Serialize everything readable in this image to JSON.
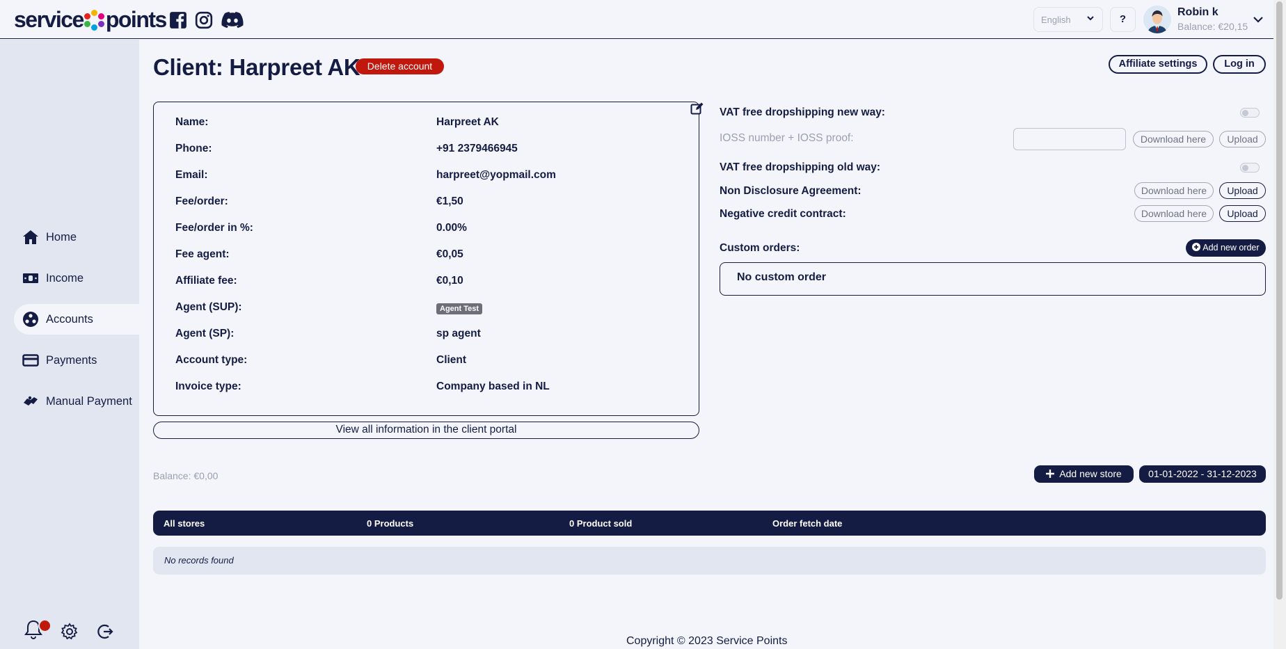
{
  "header": {
    "logo_part1": "service",
    "logo_part2": "points",
    "language": "English",
    "help_label": "?",
    "user_name": "Robin k",
    "user_balance": "Balance: €20,15"
  },
  "sidebar": {
    "items": [
      {
        "label": "Home",
        "icon": "home-icon"
      },
      {
        "label": "Income",
        "icon": "money-icon"
      },
      {
        "label": "Accounts",
        "icon": "accounts-icon"
      },
      {
        "label": "Payments",
        "icon": "card-icon"
      },
      {
        "label": "Manual Payment",
        "icon": "handshake-icon"
      }
    ],
    "bottom_icons": [
      "bell-icon",
      "gear-icon",
      "logout-icon"
    ]
  },
  "page": {
    "title": "Client: Harpreet AK",
    "delete_label": "Delete account",
    "affiliate_settings_label": "Affiliate settings",
    "login_label": "Log in"
  },
  "client_info": [
    {
      "label": "Name:",
      "value": "Harpreet AK"
    },
    {
      "label": "Phone:",
      "value": "+91 2379466945"
    },
    {
      "label": "Email:",
      "value": "harpreet@yopmail.com"
    },
    {
      "label": "Fee/order:",
      "value": "€1,50"
    },
    {
      "label": "Fee/order in %:",
      "value": "0.00%"
    },
    {
      "label": "Fee agent:",
      "value": "€0,05"
    },
    {
      "label": "Affiliate fee:",
      "value": "€0,10"
    },
    {
      "label": "Agent (SUP):",
      "value": "Agent Test"
    },
    {
      "label": "Agent (SP):",
      "value": "sp agent"
    },
    {
      "label": "Account type:",
      "value": "Client"
    },
    {
      "label": "Invoice type:",
      "value": "Company based in NL"
    }
  ],
  "view_all_label": "View all information in the client portal",
  "settings": {
    "vat_new_label": "VAT free dropshipping new way:",
    "vat_new_enabled": false,
    "ioss_label": "IOSS number + IOSS proof:",
    "ioss_value": "",
    "vat_old_label": "VAT free dropshipping old way:",
    "vat_old_enabled": false,
    "nda_label": "Non Disclosure Agreement:",
    "negative_credit_label": "Negative credit contract:",
    "download_label": "Download here",
    "upload_label": "Upload"
  },
  "custom_orders": {
    "label": "Custom orders:",
    "add_label": "Add new order",
    "empty_label": "No custom order"
  },
  "stores": {
    "balance": "Balance: €0,00",
    "add_store_label": "Add new store",
    "date_range": "01-01-2022 - 31-12-2023",
    "columns": [
      "All stores",
      "0 Products",
      "0 Product sold",
      "Order fetch date"
    ],
    "empty_label": "No records found"
  },
  "footer": "Copyright © 2023 Service Points"
}
